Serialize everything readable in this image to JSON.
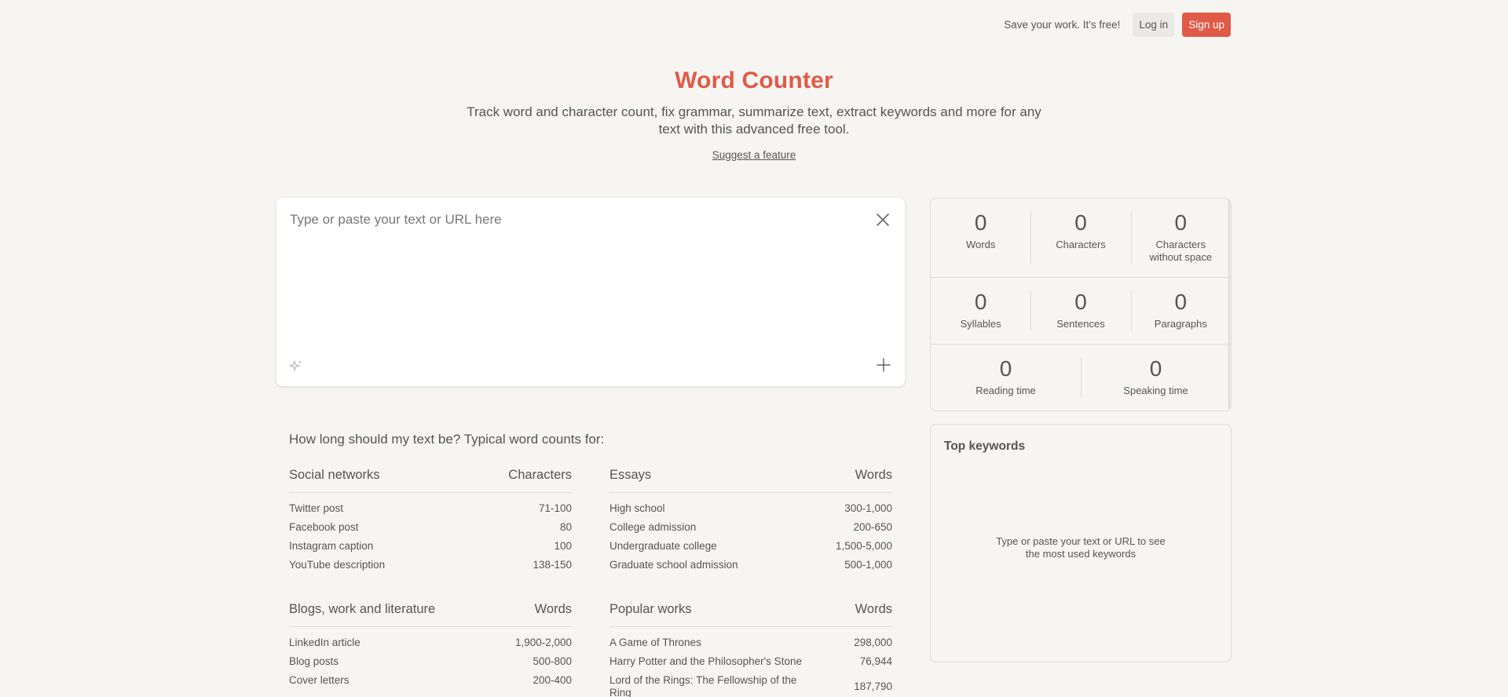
{
  "header": {
    "save_text": "Save your work. It's free!",
    "login_label": "Log in",
    "signup_label": "Sign up"
  },
  "hero": {
    "title": "Word Counter",
    "subtitle": "Track word and character count, fix grammar, summarize text, extract keywords and more for any text with this advanced free tool.",
    "suggest_link": "Suggest a feature"
  },
  "editor": {
    "placeholder": "Type or paste your text or URL here",
    "close_icon": "close-icon",
    "sparkle_icon": "sparkle-icon",
    "plus_icon": "plus-icon"
  },
  "stats": {
    "words": {
      "value": "0",
      "label": "Words"
    },
    "characters": {
      "value": "0",
      "label": "Characters"
    },
    "characters_no_space": {
      "value": "0",
      "label_1": "Characters",
      "label_2": "without space"
    },
    "syllables": {
      "value": "0",
      "label": "Syllables"
    },
    "sentences": {
      "value": "0",
      "label": "Sentences"
    },
    "paragraphs": {
      "value": "0",
      "label": "Paragraphs"
    },
    "reading_time": {
      "value": "0",
      "label": "Reading time"
    },
    "speaking_time": {
      "value": "0",
      "label": "Speaking time"
    }
  },
  "keywords": {
    "title": "Top keywords",
    "empty_line_1": "Type or paste your text or URL to see",
    "empty_line_2": "the most used keywords"
  },
  "counts": {
    "title": "How long should my text be? Typical word counts for:",
    "social": {
      "heading": "Social networks",
      "unit": "Characters",
      "rows": [
        {
          "name": "Twitter post",
          "value": "71-100"
        },
        {
          "name": "Facebook post",
          "value": "80"
        },
        {
          "name": "Instagram caption",
          "value": "100"
        },
        {
          "name": "YouTube description",
          "value": "138-150"
        }
      ]
    },
    "essays": {
      "heading": "Essays",
      "unit": "Words",
      "rows": [
        {
          "name": "High school",
          "value": "300-1,000"
        },
        {
          "name": "College admission",
          "value": "200-650"
        },
        {
          "name": "Undergraduate college",
          "value": "1,500-5,000"
        },
        {
          "name": "Graduate school admission",
          "value": "500-1,000"
        }
      ]
    },
    "blogs": {
      "heading": "Blogs, work and literature",
      "unit": "Words",
      "rows": [
        {
          "name": "LinkedIn article",
          "value": "1,900-2,000"
        },
        {
          "name": "Blog posts",
          "value": "500-800"
        },
        {
          "name": "Cover letters",
          "value": "200-400"
        }
      ]
    },
    "popular": {
      "heading": "Popular works",
      "unit": "Words",
      "rows": [
        {
          "name": "A Game of Thrones",
          "value": "298,000"
        },
        {
          "name": "Harry Potter and the Philosopher's Stone",
          "value": "76,944"
        },
        {
          "name": "Lord of the Rings: The Fellowship of the Ring",
          "value": "187,790"
        }
      ]
    }
  },
  "colors": {
    "accent": "#e05a47",
    "background": "#f6f5f2",
    "border": "#dedcd8"
  }
}
